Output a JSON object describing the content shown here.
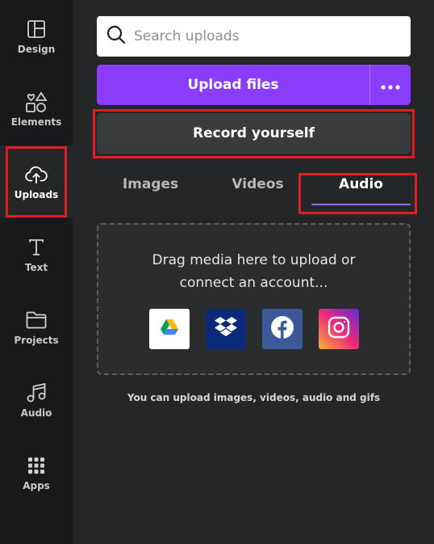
{
  "sidebar": {
    "items": [
      {
        "label": "Design",
        "icon": "layout-icon"
      },
      {
        "label": "Elements",
        "icon": "shapes-icon"
      },
      {
        "label": "Uploads",
        "icon": "cloud-upload-icon",
        "active": true
      },
      {
        "label": "Text",
        "icon": "text-icon"
      },
      {
        "label": "Projects",
        "icon": "folder-icon"
      },
      {
        "label": "Audio",
        "icon": "music-note-icon"
      },
      {
        "label": "Apps",
        "icon": "grid-icon"
      }
    ]
  },
  "search": {
    "placeholder": "Search uploads",
    "value": ""
  },
  "upload": {
    "label": "Upload files",
    "more_icon": "more-horizontal-icon"
  },
  "record": {
    "label": "Record yourself"
  },
  "tabs": [
    {
      "label": "Images"
    },
    {
      "label": "Videos"
    },
    {
      "label": "Audio",
      "active": true
    }
  ],
  "dropzone": {
    "line1": "Drag media here to upload or",
    "line2": "connect an account...",
    "sources": [
      "google-drive-icon",
      "dropbox-icon",
      "facebook-icon",
      "instagram-icon"
    ]
  },
  "hint": "You can upload images, videos, audio and gifs",
  "colors": {
    "accent": "#8b3dff",
    "highlight": "#e11d24",
    "rail_bg": "#18191b",
    "panel_bg": "#252627"
  }
}
